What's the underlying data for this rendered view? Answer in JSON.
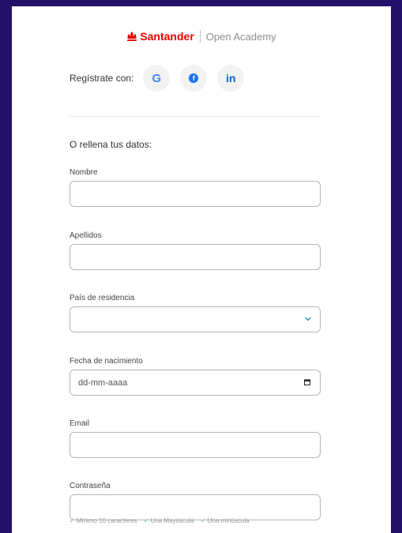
{
  "brand": {
    "name": "Santander",
    "product": "Open Academy",
    "color": "#ec0000"
  },
  "social": {
    "label": "Regístrate con:",
    "providers": [
      {
        "name": "Google",
        "glyph": "G"
      },
      {
        "name": "Facebook",
        "glyph": "f"
      },
      {
        "name": "LinkedIn",
        "glyph": "in"
      }
    ]
  },
  "form": {
    "subtitle": "O rellena tus datos:",
    "nombre": {
      "label": "Nombre",
      "value": ""
    },
    "apellidos": {
      "label": "Apellidos",
      "value": ""
    },
    "pais": {
      "label": "País de residencia",
      "value": ""
    },
    "fecha": {
      "label": "Fecha de nacimiento",
      "placeholder": "dd-mm-aaaa"
    },
    "email": {
      "label": "Email",
      "value": ""
    },
    "password": {
      "label": "Contraseña",
      "value": ""
    }
  },
  "password_hints": [
    "Mínimo 10 caracteres",
    "Una Mayúscula",
    "Una minúscula"
  ],
  "colors": {
    "background": "#231068",
    "accent": "#ec0000",
    "hint_check": "#6abf69"
  }
}
